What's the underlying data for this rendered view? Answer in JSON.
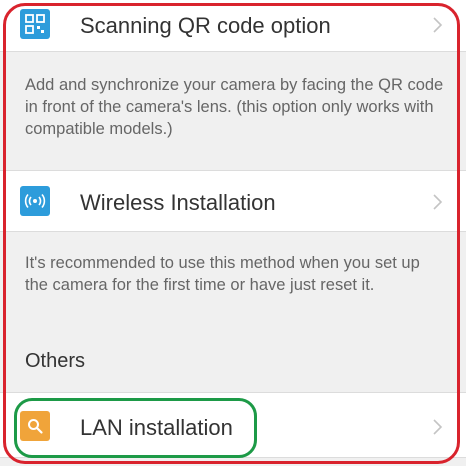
{
  "options": {
    "qr": {
      "label": "Scanning QR code option",
      "icon": "qr-code-icon",
      "icon_color": "#2d9cdb",
      "description": "Add and synchronize your camera by facing the QR code in front of the camera's lens. (this option only works with compatible models.)"
    },
    "wireless": {
      "label": "Wireless Installation",
      "icon": "wifi-signal-icon",
      "icon_color": "#2d9cdb",
      "description": "It's recommended to use this method when you set up the camera for the first time or have just reset it."
    },
    "section_others": "Others",
    "lan": {
      "label": "LAN installation",
      "icon": "search-icon",
      "icon_color": "#f0a43a"
    }
  },
  "highlight_colors": {
    "outer_frame": "#d9232d",
    "lan_frame": "#1d9a47"
  }
}
